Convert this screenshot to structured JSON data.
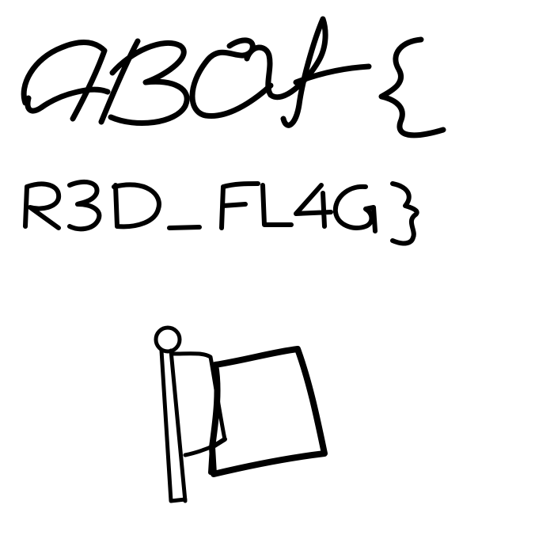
{
  "handwriting": {
    "line1": "ABCY{",
    "line2": "R3D_FL4G}"
  },
  "flag": {
    "icon": "flag-icon"
  },
  "colors": {
    "background": "#ffffff",
    "ink": "#000000"
  }
}
